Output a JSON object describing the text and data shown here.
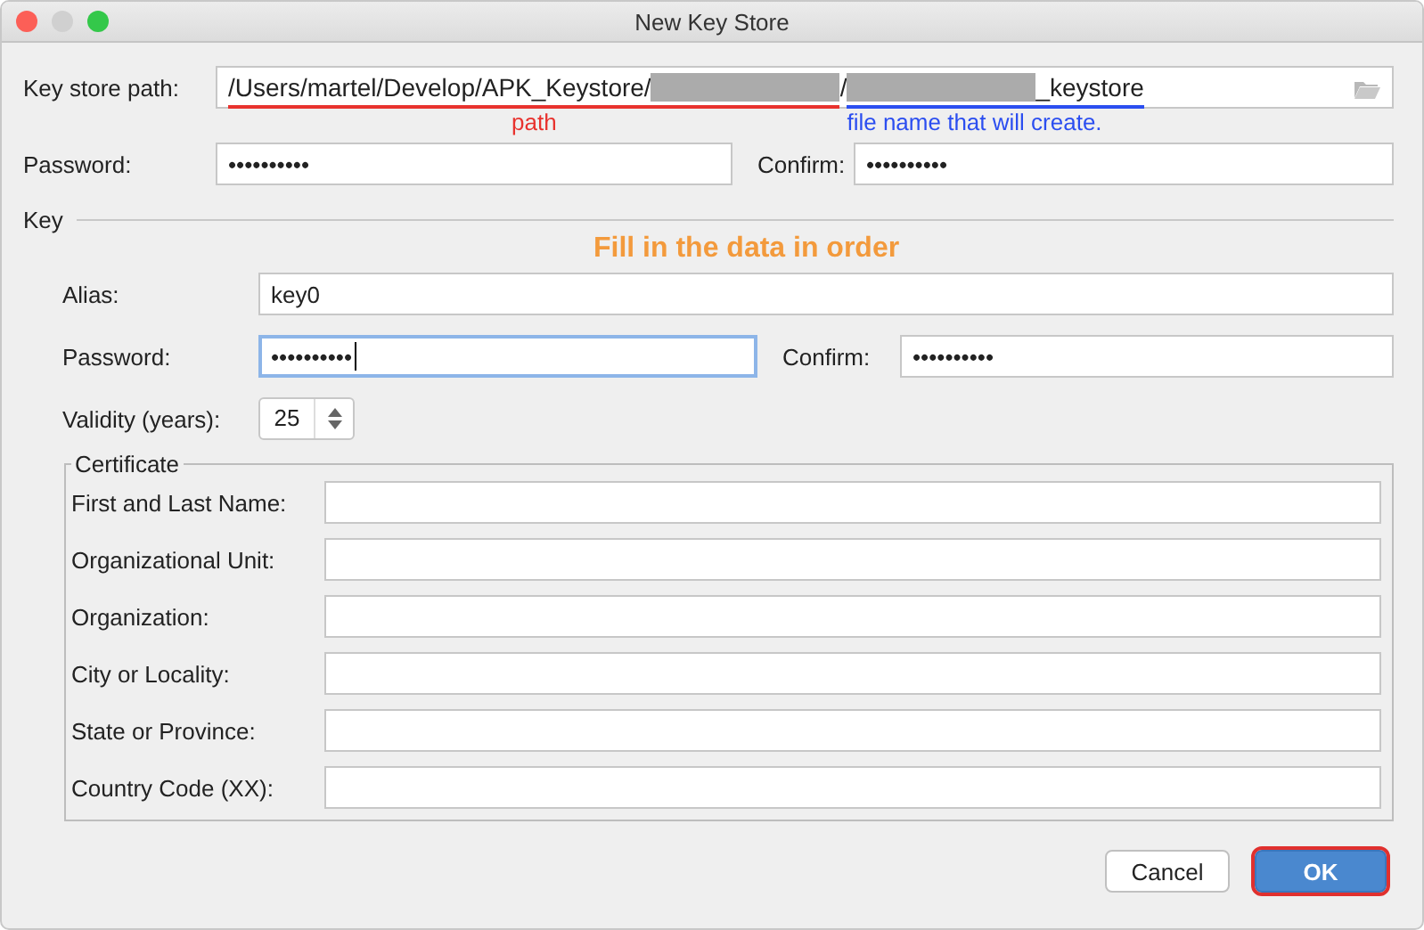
{
  "window": {
    "title": "New Key Store"
  },
  "key_store": {
    "path_label": "Key store path:",
    "path_parts": [
      {
        "note": "path",
        "color": "#e8322e",
        "segments": [
          {
            "kind": "text",
            "text": "/Users/martel/Develop/APK_Keystore/"
          },
          {
            "kind": "redacted"
          }
        ]
      },
      {
        "segments": [
          {
            "kind": "text",
            "text": "/"
          }
        ]
      },
      {
        "note": "file name that will create.",
        "color": "#2b4ef0",
        "segments": [
          {
            "kind": "redacted"
          },
          {
            "kind": "text",
            "text": "_keystore"
          }
        ]
      }
    ],
    "password_label": "Password:",
    "password": "••••••••••",
    "confirm_label": "Confirm:",
    "confirm": "••••••••••"
  },
  "key": {
    "section_label": "Key",
    "instruction": "Fill in the data in order",
    "alias_label": "Alias:",
    "alias": "key0",
    "password_label": "Password:",
    "password": "••••••••••",
    "password_focused": true,
    "confirm_label": "Confirm:",
    "confirm": "••••••••••",
    "validity_label": "Validity (years):",
    "validity": "25"
  },
  "certificate": {
    "title": "Certificate",
    "fields": [
      {
        "label": "First and Last Name:"
      },
      {
        "label": "Organizational Unit:"
      },
      {
        "label": "Organization:"
      },
      {
        "label": "City or Locality:"
      },
      {
        "label": "State or Province:"
      },
      {
        "label": "Country Code (XX):"
      }
    ]
  },
  "buttons": [
    {
      "label": "Cancel",
      "kind": "default",
      "highlighted": false
    },
    {
      "label": "OK",
      "kind": "primary",
      "highlighted": true
    }
  ]
}
